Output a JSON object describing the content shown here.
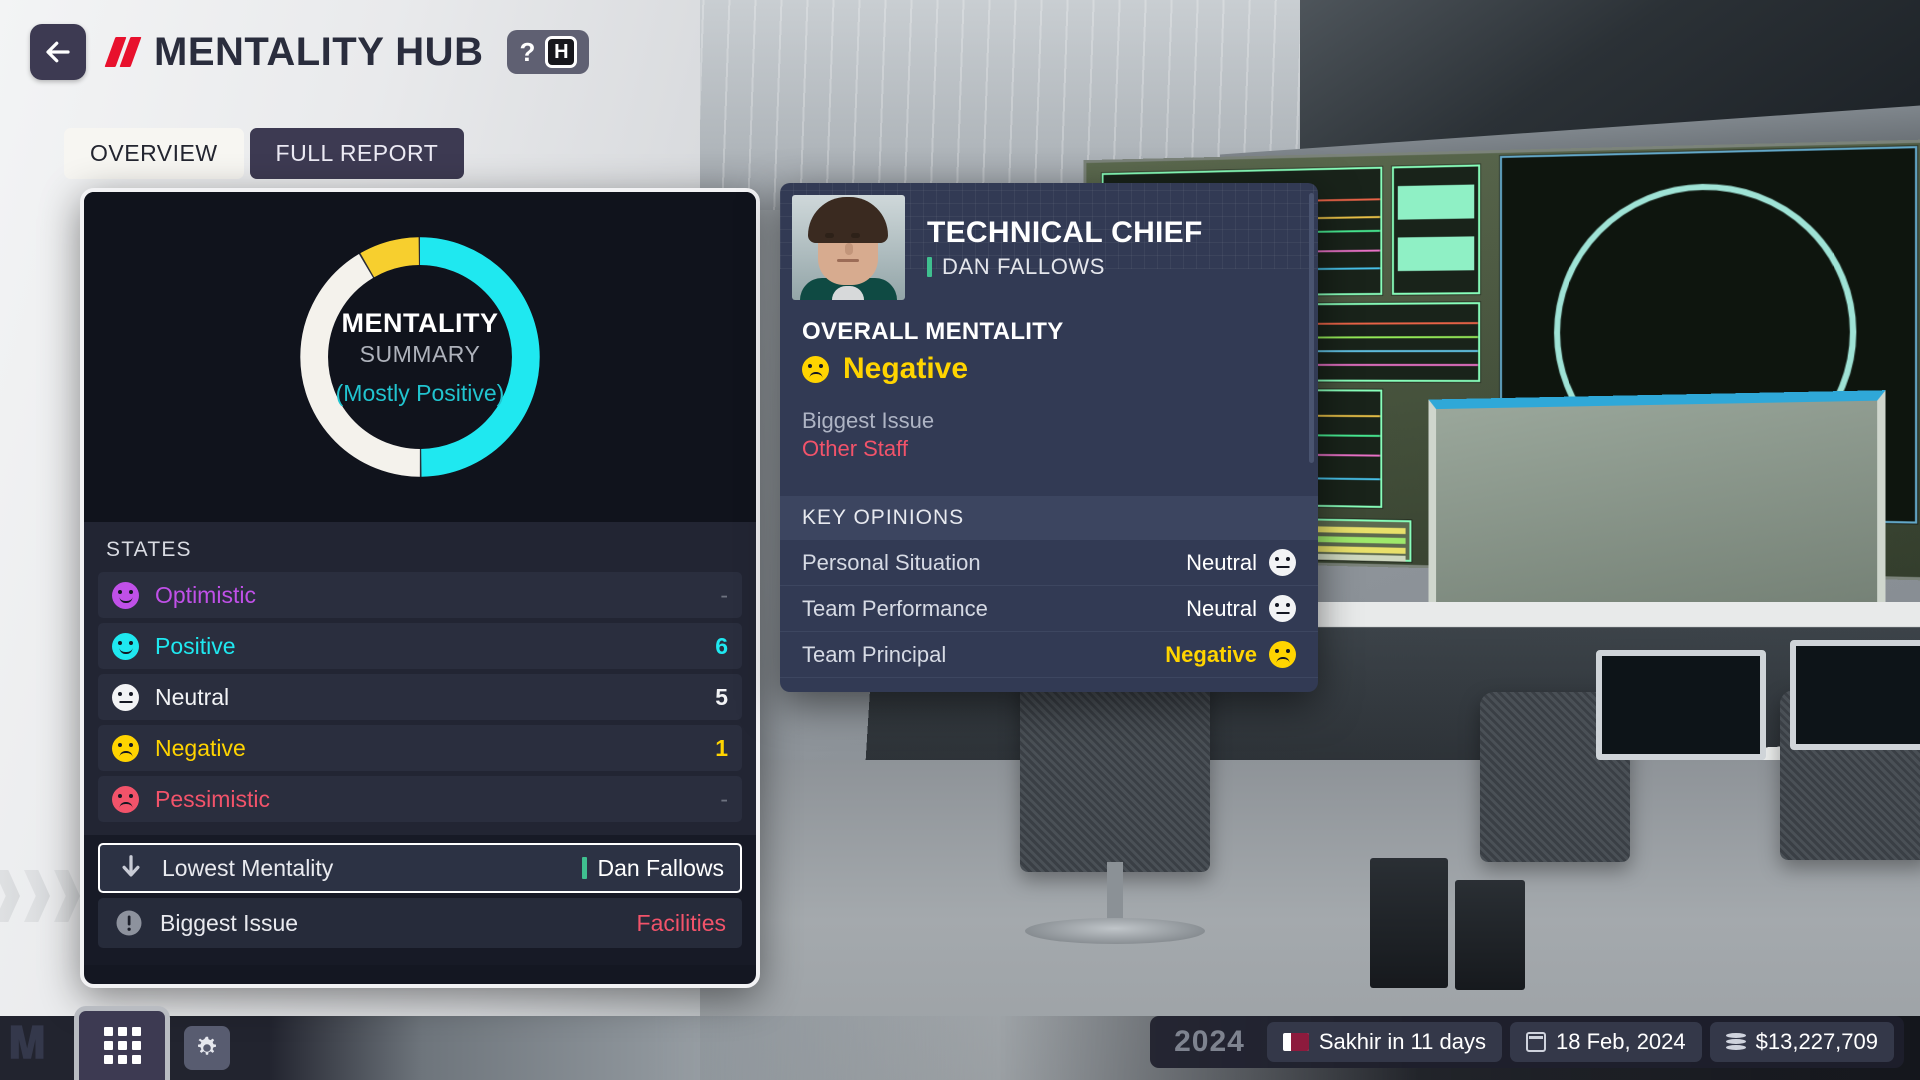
{
  "header": {
    "back_icon": "arrow-left-icon",
    "brand_slashes": "//",
    "title": "MENTALITY HUB",
    "help_label": "?",
    "hotkey_label": "H"
  },
  "tabs": [
    {
      "label": "OVERVIEW",
      "active": true
    },
    {
      "label": "FULL REPORT",
      "active": false
    }
  ],
  "summary": {
    "title_line1": "MENTALITY",
    "title_line2": "SUMMARY",
    "verdict": "(Mostly Positive)",
    "states_header": "STATES"
  },
  "chart_data": {
    "type": "pie",
    "title": "Mentality Summary",
    "categories": [
      "Positive",
      "Neutral",
      "Negative"
    ],
    "values": [
      6,
      5,
      1
    ],
    "colors": [
      "#1fe8f0",
      "#f4f2ec",
      "#f7cf2e"
    ],
    "total": 12,
    "annotation": "(Mostly Positive)",
    "legend_position": "below",
    "grid": false
  },
  "states": [
    {
      "label": "Optimistic",
      "value": "-",
      "color": "#c050e8",
      "face": "smile"
    },
    {
      "label": "Positive",
      "value": "6",
      "color": "#1fe8f0",
      "face": "smile"
    },
    {
      "label": "Neutral",
      "value": "5",
      "color": "#f2f3f5",
      "face": "flat"
    },
    {
      "label": "Negative",
      "value": "1",
      "color": "#ffd400",
      "face": "sad"
    },
    {
      "label": "Pessimistic",
      "value": "-",
      "color": "#f2536a",
      "face": "sad"
    }
  ],
  "bottom_rows": [
    {
      "label": "Lowest Mentality",
      "value": "Dan Fallows",
      "icon": "arrow-down-icon",
      "highlighted": true,
      "tick": true
    },
    {
      "label": "Biggest Issue",
      "value": "Facilities",
      "icon": "exclamation-icon",
      "highlighted": false,
      "tick": false
    }
  ],
  "staff_card": {
    "role": "TECHNICAL CHIEF",
    "name": "DAN FALLOWS",
    "overall_label": "OVERALL MENTALITY",
    "overall_value": "Negative",
    "overall_color": "#ffd400",
    "issue_label": "Biggest Issue",
    "issue_value": "Other Staff",
    "issue_color": "#f2536a",
    "key_opinions_header": "KEY OPINIONS",
    "key_opinions": [
      {
        "label": "Personal Situation",
        "value": "Neutral",
        "face": "flat",
        "tone": "neutral"
      },
      {
        "label": "Team Performance",
        "value": "Neutral",
        "face": "flat",
        "tone": "neutral"
      },
      {
        "label": "Team Principal",
        "value": "Negative",
        "face": "sad",
        "tone": "negative"
      }
    ]
  },
  "taskbar": {
    "apps_icon": "grid-apps-icon",
    "settings_icon": "gear-icon"
  },
  "statusbar": {
    "year": "2024",
    "next_race": "Sakhir in 11 days",
    "race_flag": "qatar-flag-icon",
    "date": "18 Feb, 2024",
    "calendar_icon": "calendar-icon",
    "money": "$13,227,709",
    "money_icon": "coins-icon"
  }
}
